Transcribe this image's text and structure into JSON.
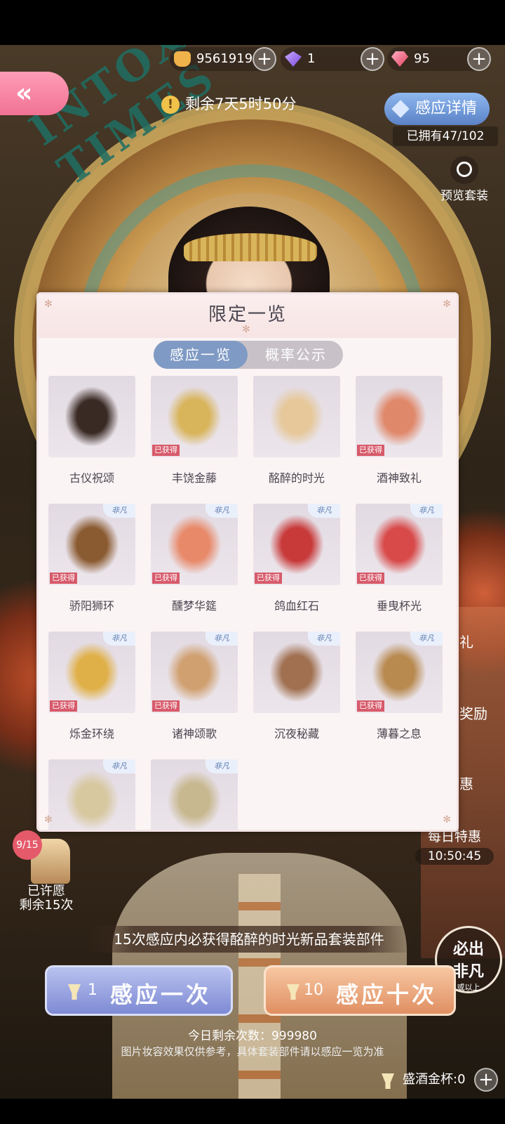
{
  "resources": {
    "coins": "9561919",
    "gems": "1",
    "diamonds": "95",
    "plus": "+"
  },
  "event": {
    "back_label": "«",
    "timer_icon": "!",
    "timer": "剩余7天5时50分",
    "banner_text": "INTOXICATING TIMES",
    "detail_button": "感应详情",
    "owned": "已拥有47/102",
    "preview": "预览套装"
  },
  "side_labels": [
    "礼",
    "奖励",
    "惠"
  ],
  "daily": {
    "name": "每日特惠",
    "time": "10:50:45"
  },
  "wish": {
    "counter": "9/15",
    "status": "已许愿",
    "remaining": "剩余15次"
  },
  "guarantee_banner": "15次感应内必获得酩醉的时光新品套装部件",
  "guarantee_badge": {
    "line1": "必出",
    "line2": "非凡",
    "line3": "或以上"
  },
  "draw_one": {
    "cost": "1",
    "label": "感应一次"
  },
  "draw_ten": {
    "cost": "10",
    "label": "感应十次"
  },
  "today_remaining": "今日剩余次数：999980",
  "disclaimer": "图片妆容效果仅供参考，具体套装部件请以感应一览为准",
  "cups": "盛酒金杯:0",
  "modal": {
    "title": "限定一览",
    "tabs": [
      "感应一览",
      "概率公示"
    ],
    "rare_label": "非凡",
    "obtained_label": "已获得",
    "items": [
      {
        "name": "古仪祝颂",
        "obtained": false,
        "icon": "hair-icon"
      },
      {
        "name": "丰饶金藤",
        "obtained": true,
        "icon": "vine-headpiece-icon"
      },
      {
        "name": "酩醉的时光",
        "obtained": false,
        "icon": "dress-icon"
      },
      {
        "name": "酒神致礼",
        "obtained": true,
        "icon": "goblet-scarf-icon"
      },
      {
        "name": "骄阳狮环",
        "obtained": true,
        "icon": "vanity-icon"
      },
      {
        "name": "醺梦华筵",
        "obtained": true,
        "icon": "shoes-icon"
      },
      {
        "name": "鸽血红石",
        "obtained": true,
        "icon": "bracelet-icon"
      },
      {
        "name": "垂曳杯光",
        "obtained": true,
        "icon": "earrings-icon"
      },
      {
        "name": "烁金环绕",
        "obtained": true,
        "icon": "bangle-icon"
      },
      {
        "name": "诸神颂歌",
        "obtained": true,
        "icon": "scepter-icon"
      },
      {
        "name": "沉夜秘藏",
        "obtained": false,
        "icon": "makeup-box-icon"
      },
      {
        "name": "薄暮之息",
        "obtained": true,
        "icon": "vanity-set-icon"
      },
      {
        "name": "",
        "obtained": false,
        "icon": "mascara-icon"
      },
      {
        "name": "",
        "obtained": false,
        "icon": "brush-icon"
      }
    ]
  }
}
